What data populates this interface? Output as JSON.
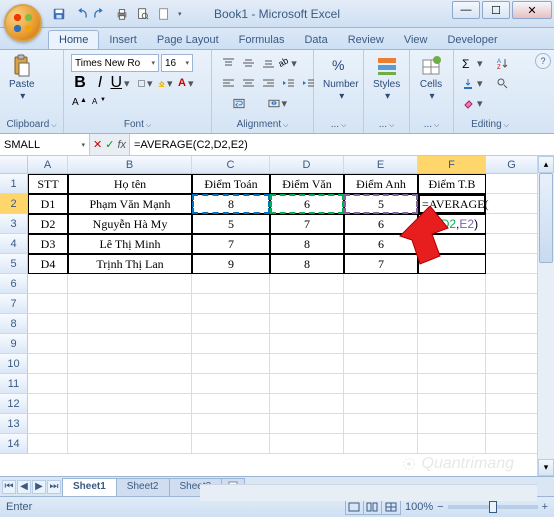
{
  "title": "Book1 - Microsoft Excel",
  "qat_icons": [
    "save",
    "undo",
    "redo",
    "print",
    "preview",
    "new"
  ],
  "tabs": [
    "Home",
    "Insert",
    "Page Layout",
    "Formulas",
    "Data",
    "Review",
    "View",
    "Developer"
  ],
  "active_tab": "Home",
  "ribbon": {
    "clipboard": {
      "label": "Clipboard",
      "paste": "Paste"
    },
    "font": {
      "label": "Font",
      "name": "Times New Ro",
      "size": "16"
    },
    "alignment": {
      "label": "Alignment"
    },
    "number": {
      "label": "...",
      "big": "Number"
    },
    "styles": {
      "label": "...",
      "big": "Styles"
    },
    "cells": {
      "label": "...",
      "big": "Cells"
    },
    "editing": {
      "label": "Editing"
    }
  },
  "name_box": "SMALL",
  "formula": "=AVERAGE(C2,D2,E2)",
  "columns": [
    "A",
    "B",
    "C",
    "D",
    "E",
    "F",
    "G"
  ],
  "headers": {
    "A": "STT",
    "B": "Họ tên",
    "C": "Điểm Toán",
    "D": "Điểm Văn",
    "E": "Điểm Anh",
    "F": "Điểm T.B"
  },
  "rows": [
    {
      "n": "1"
    },
    {
      "n": "2",
      "A": "D1",
      "B": "Phạm Văn Mạnh",
      "C": "8",
      "D": "6",
      "E": "5",
      "F": "=AVERAGE("
    },
    {
      "n": "3",
      "A": "D2",
      "B": "Nguyễn Hà My",
      "C": "5",
      "D": "7",
      "E": "6",
      "F_parts": [
        [
          "C2",
          "#0070C0"
        ],
        [
          ",",
          "#000"
        ],
        [
          "D2",
          "#00B050"
        ],
        [
          ",",
          "#000"
        ],
        [
          "E2",
          "#8064A2"
        ],
        [
          ")",
          "#000"
        ]
      ]
    },
    {
      "n": "4",
      "A": "D3",
      "B": "Lê Thị Minh",
      "C": "7",
      "D": "8",
      "E": "6"
    },
    {
      "n": "5",
      "A": "D4",
      "B": "Trịnh Thị Lan",
      "C": "9",
      "D": "8",
      "E": "7"
    },
    {
      "n": "6"
    },
    {
      "n": "7"
    },
    {
      "n": "8"
    },
    {
      "n": "9"
    },
    {
      "n": "10"
    },
    {
      "n": "11"
    },
    {
      "n": "12"
    },
    {
      "n": "13"
    },
    {
      "n": "14"
    }
  ],
  "sheets": [
    "Sheet1",
    "Sheet2",
    "Sheet3"
  ],
  "active_sheet": "Sheet1",
  "status_mode": "Enter",
  "zoom": "100%",
  "watermark": "Quantrimang"
}
